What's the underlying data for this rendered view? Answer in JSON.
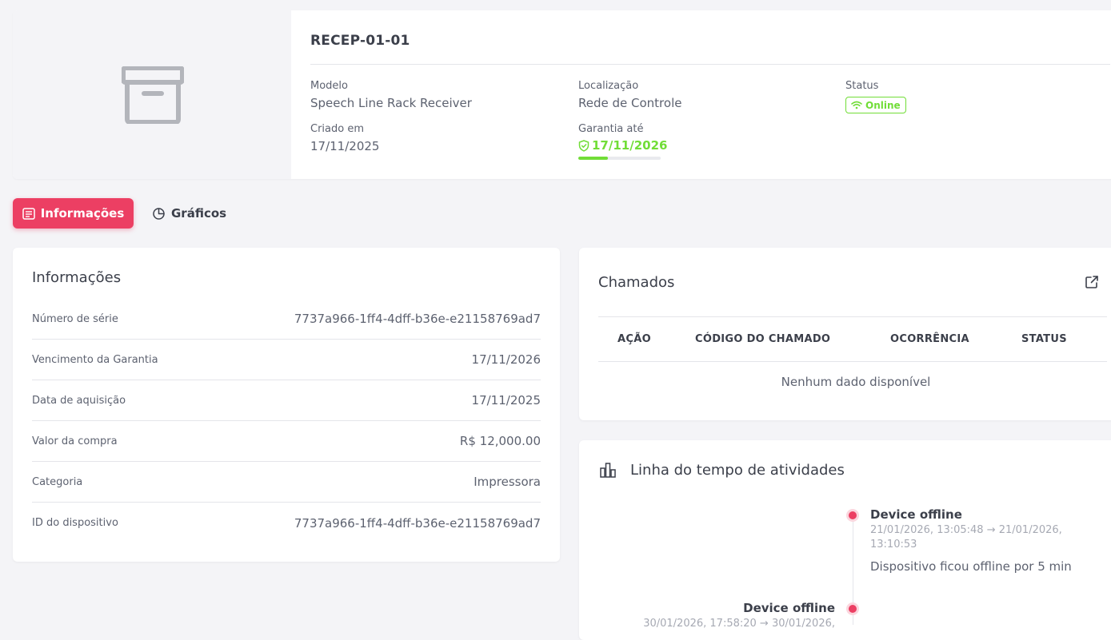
{
  "device": {
    "title": "RECEP-01-01",
    "modelo_label": "Modelo",
    "modelo_value": "Speech Line Rack Receiver",
    "localizacao_label": "Localização",
    "localizacao_value": "Rede de Controle",
    "status_label": "Status",
    "status_value": "Online",
    "criado_label": "Criado em",
    "criado_value": "17/11/2025",
    "garantia_label": "Garantia até",
    "garantia_value": "17/11/2026",
    "garantia_progress_percent": 36
  },
  "tabs": [
    {
      "label": "Informações",
      "icon": "list-icon",
      "active": true
    },
    {
      "label": "Gráficos",
      "icon": "pie-chart-icon",
      "active": false
    }
  ],
  "info": {
    "title": "Informações",
    "rows": [
      {
        "key": "Número de série",
        "value": "7737a966-1ff4-4dff-b36e-e21158769ad7"
      },
      {
        "key": "Vencimento da Garantia",
        "value": "17/11/2026"
      },
      {
        "key": "Data de aquisição",
        "value": "17/11/2025"
      },
      {
        "key": "Valor da compra",
        "value": "R$ 12,000.00"
      },
      {
        "key": "Categoria",
        "value": "Impressora"
      },
      {
        "key": "ID do dispositivo",
        "value": "7737a966-1ff4-4dff-b36e-e21158769ad7"
      }
    ]
  },
  "chamados": {
    "title": "Chamados",
    "columns": [
      "AÇÃO",
      "CÓDIGO DO CHAMADO",
      "OCORRÊNCIA",
      "STATUS"
    ],
    "empty_text": "Nenhum dado disponível"
  },
  "timeline": {
    "title": "Linha do tempo de atividades",
    "events": [
      {
        "title": "Device offline",
        "time_line1": "21/01/2026, 13:05:48 → 21/01/2026,",
        "time_line2": "13:10:53",
        "description": "Dispositivo ficou offline por 5 min"
      },
      {
        "title": "Device offline",
        "time_line1": "30/01/2026, 17:58:20 → 30/01/2026,"
      }
    ]
  },
  "colors": {
    "accent": "#ec3f63",
    "success": "#71dd37",
    "background": "#f4f4f7"
  }
}
